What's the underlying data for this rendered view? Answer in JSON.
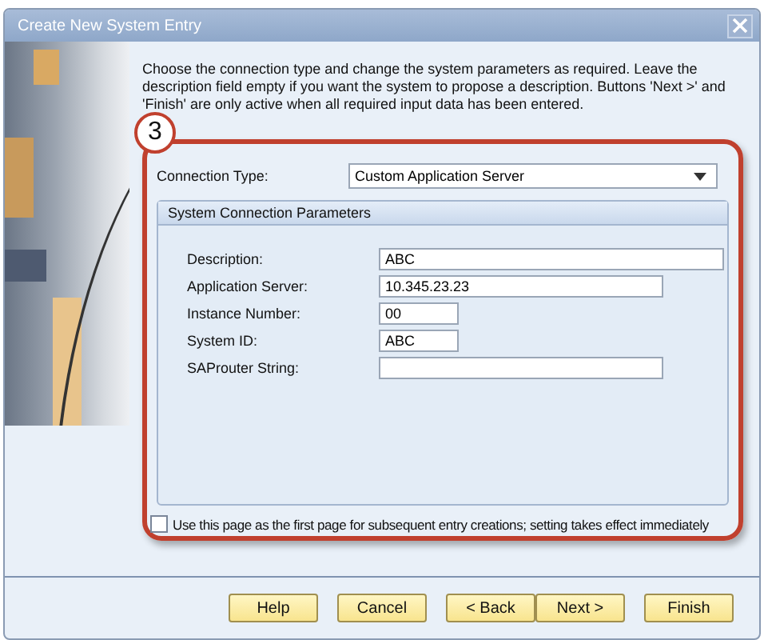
{
  "window": {
    "title": "Create New System Entry"
  },
  "intro": "Choose the connection type and change the system parameters as required. Leave the description field empty if you want the system to propose a description. Buttons 'Next >' and 'Finish' are only active when all required input data has been entered.",
  "annotation": "3",
  "connection_type": {
    "label": "Connection Type:",
    "value": "Custom Application Server"
  },
  "group": {
    "title": "System Connection Parameters",
    "fields": [
      {
        "label": "Description:",
        "value": "ABC"
      },
      {
        "label": "Application Server:",
        "value": "10.345.23.23"
      },
      {
        "label": "Instance Number:",
        "value": "00"
      },
      {
        "label": "System ID:",
        "value": "ABC"
      },
      {
        "label": "SAProuter String:"
      }
    ]
  },
  "first_page_option": {
    "label": "Use this page as the first page for subsequent entry creations; setting takes effect immediately",
    "checked": false
  },
  "buttons": [
    "Help",
    "Cancel",
    "< Back",
    "Next >",
    "Finish"
  ]
}
